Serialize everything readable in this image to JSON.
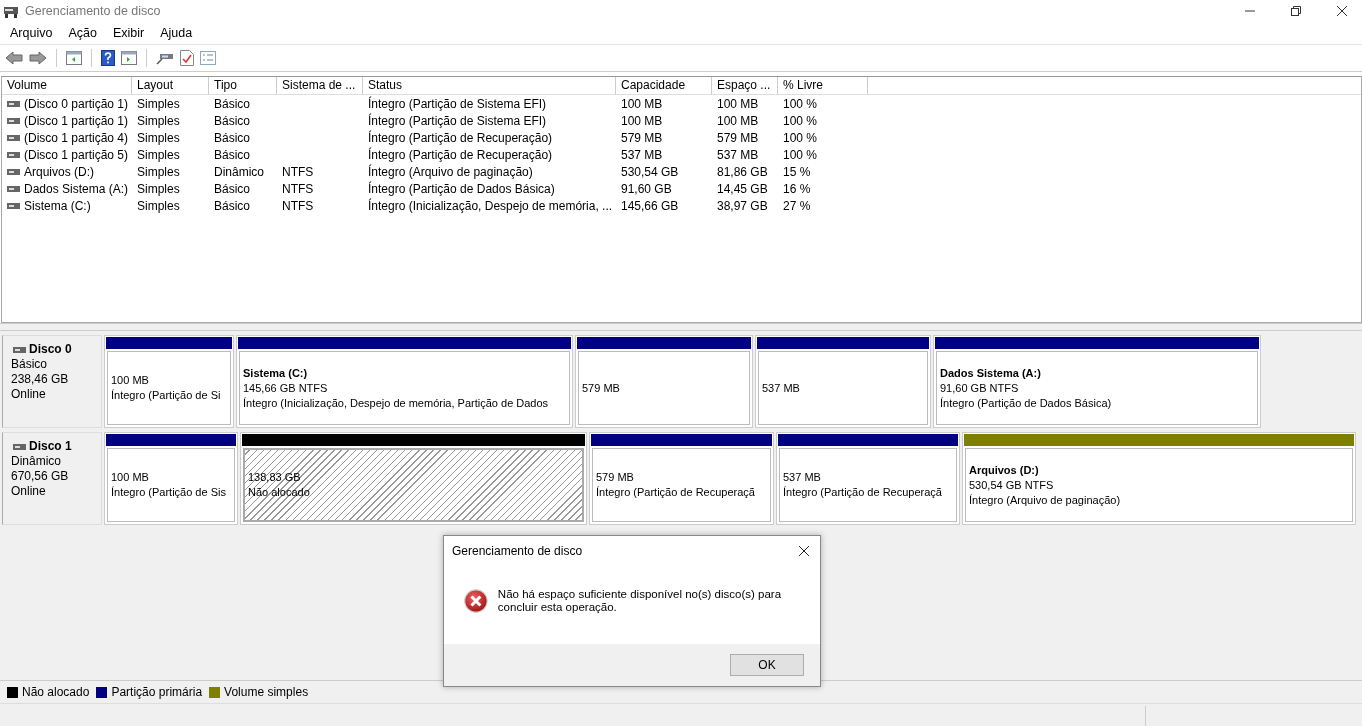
{
  "window": {
    "title": "Gerenciamento de disco"
  },
  "menu": [
    "Arquivo",
    "Ação",
    "Exibir",
    "Ajuda"
  ],
  "table": {
    "columns": [
      "Volume",
      "Layout",
      "Tipo",
      "Sistema de ...",
      "Status",
      "Capacidade",
      "Espaço ...",
      "% Livre"
    ],
    "rows": [
      [
        "(Disco 0 partição 1)",
        "Simples",
        "Básico",
        "",
        "Íntegro (Partição de Sistema EFI)",
        "100 MB",
        "100 MB",
        "100 %"
      ],
      [
        "(Disco 1 partição 1)",
        "Simples",
        "Básico",
        "",
        "Íntegro (Partição de Sistema EFI)",
        "100 MB",
        "100 MB",
        "100 %"
      ],
      [
        "(Disco 1 partição 4)",
        "Simples",
        "Básico",
        "",
        "Íntegro (Partição de Recuperação)",
        "579 MB",
        "579 MB",
        "100 %"
      ],
      [
        "(Disco 1 partição 5)",
        "Simples",
        "Básico",
        "",
        "Íntegro (Partição de Recuperação)",
        "537 MB",
        "537 MB",
        "100 %"
      ],
      [
        "Arquivos (D:)",
        "Simples",
        "Dinâmico",
        "NTFS",
        "Íntegro (Arquivo de paginação)",
        "530,54 GB",
        "81,86 GB",
        "15 %"
      ],
      [
        "Dados Sistema (A:)",
        "Simples",
        "Básico",
        "NTFS",
        "Íntegro (Partição de Dados Básica)",
        "91,60 GB",
        "14,45 GB",
        "16 %"
      ],
      [
        "Sistema (C:)",
        "Simples",
        "Básico",
        "NTFS",
        "Íntegro (Inicialização, Despejo de memória, ...",
        "145,66 GB",
        "38,97 GB",
        "27 %"
      ]
    ]
  },
  "disks": [
    {
      "name": "Disco 0",
      "type": "Básico",
      "size": "238,46 GB",
      "status": "Online",
      "partitions": [
        {
          "kind": "primary",
          "color": "#000080",
          "lines": [
            "100 MB",
            "Íntegro (Partição de Si"
          ]
        },
        {
          "kind": "primary",
          "color": "#000080",
          "title": "Sistema  (C:)",
          "lines": [
            "145,66 GB NTFS",
            "Íntegro (Inicialização, Despejo de memória, Partição de Dados"
          ]
        },
        {
          "kind": "primary",
          "color": "#000080",
          "lines": [
            "579 MB"
          ]
        },
        {
          "kind": "primary",
          "color": "#000080",
          "lines": [
            "537 MB"
          ]
        },
        {
          "kind": "primary",
          "color": "#000080",
          "title": "Dados Sistema  (A:)",
          "lines": [
            "91,60 GB NTFS",
            "Íntegro (Partição de Dados Básica)"
          ]
        }
      ]
    },
    {
      "name": "Disco 1",
      "type": "Dinâmico",
      "size": "670,56 GB",
      "status": "Online",
      "partitions": [
        {
          "kind": "primary",
          "color": "#000080",
          "lines": [
            "100 MB",
            "Íntegro (Partição de Sis"
          ]
        },
        {
          "kind": "unallocated",
          "color": "#000000",
          "lines": [
            "138,83 GB",
            "Não alocado"
          ]
        },
        {
          "kind": "primary",
          "color": "#000080",
          "lines": [
            "579 MB",
            "Íntegro (Partição de Recuperaçã"
          ]
        },
        {
          "kind": "primary",
          "color": "#000080",
          "lines": [
            "537 MB",
            "Íntegro (Partição de Recuperaçã"
          ]
        },
        {
          "kind": "simple",
          "color": "#808000",
          "title": "Arquivos  (D:)",
          "lines": [
            "530,54 GB NTFS",
            "Íntegro (Arquivo de paginação)"
          ]
        }
      ]
    }
  ],
  "legend": [
    {
      "label": "Não alocado",
      "color": "#000000"
    },
    {
      "label": "Partição primária",
      "color": "#000080"
    },
    {
      "label": "Volume simples",
      "color": "#808000"
    }
  ],
  "dialog": {
    "title": "Gerenciamento de disco",
    "message": "Não há espaço suficiente disponível no(s) disco(s) para concluir esta operação.",
    "button": "OK"
  }
}
